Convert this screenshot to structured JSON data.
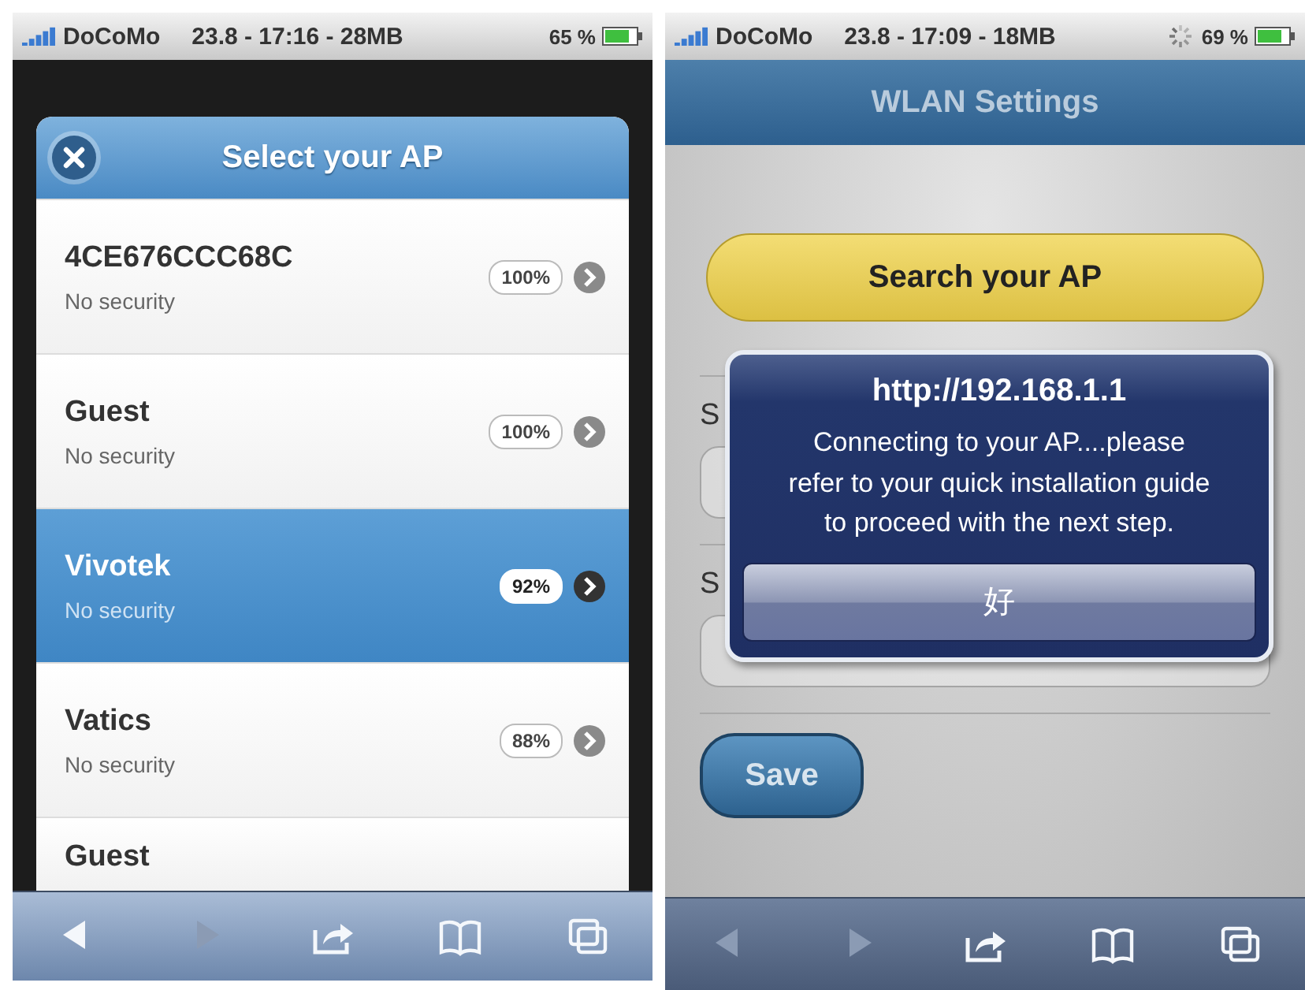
{
  "left_screen": {
    "status_bar": {
      "carrier": "DoCoMo",
      "center": "23.8 - 17:16 - 28MB",
      "battery": "65 %",
      "busy": false
    },
    "dialog": {
      "title": "Select your AP",
      "items": [
        {
          "name": "4CE676CCC68C",
          "security": "No security",
          "signal": "100%",
          "selected": false
        },
        {
          "name": "Guest",
          "security": "No security",
          "signal": "100%",
          "selected": false
        },
        {
          "name": "Vivotek",
          "security": "No security",
          "signal": "92%",
          "selected": true
        },
        {
          "name": "Vatics",
          "security": "No security",
          "signal": "88%",
          "selected": false
        },
        {
          "name": "Guest",
          "selected": false
        }
      ]
    },
    "toolbar": [
      {
        "kind": "back",
        "disabled": false
      },
      {
        "kind": "forward",
        "disabled": true
      },
      {
        "kind": "share",
        "disabled": false
      },
      {
        "kind": "bookmarks",
        "disabled": false
      },
      {
        "kind": "tabs",
        "disabled": false
      }
    ]
  },
  "right_screen": {
    "status_bar": {
      "carrier": "DoCoMo",
      "center": "23.8 - 17:09 - 18MB",
      "battery": "69 %",
      "busy": true
    },
    "header": {
      "title": "WLAN Settings"
    },
    "search_button": "Search your AP",
    "form": {
      "ssid_label": "S",
      "security_label": "S"
    },
    "save_button": "Save",
    "alert": {
      "title": "http://192.168.1.1",
      "message": "Connecting to your AP....please refer to your quick installation guide to proceed with the next step.",
      "button": "好"
    },
    "toolbar": [
      {
        "kind": "back",
        "disabled": true
      },
      {
        "kind": "forward",
        "disabled": true
      },
      {
        "kind": "share",
        "disabled": false
      },
      {
        "kind": "bookmarks",
        "disabled": false
      },
      {
        "kind": "tabs",
        "disabled": false
      }
    ]
  }
}
